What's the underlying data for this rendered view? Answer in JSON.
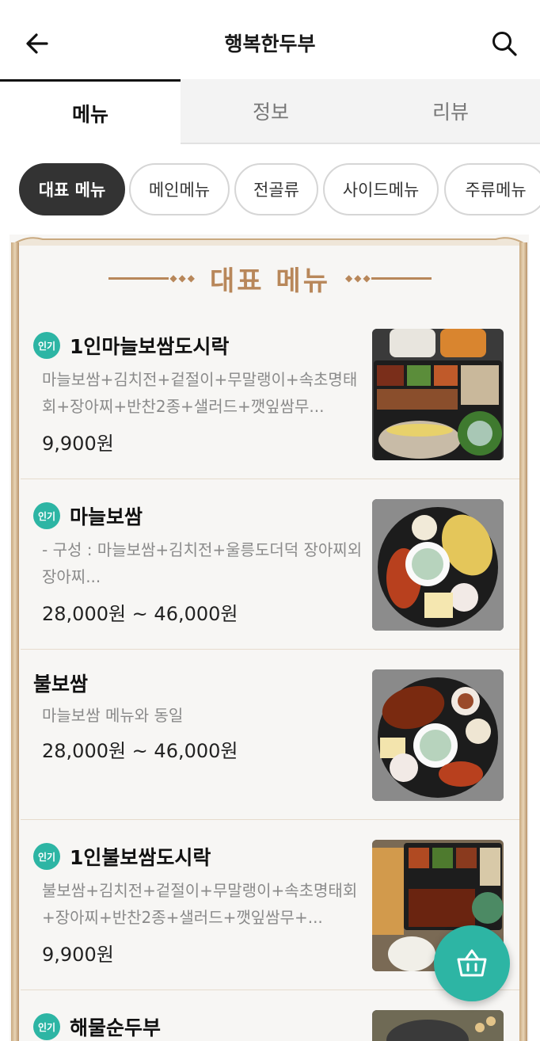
{
  "header": {
    "title": "행복한두부"
  },
  "tabs": [
    {
      "label": "메뉴",
      "active": true
    },
    {
      "label": "정보",
      "active": false
    },
    {
      "label": "리뷰",
      "active": false
    }
  ],
  "chips": [
    {
      "label": "대표 메뉴",
      "active": true
    },
    {
      "label": "메인메뉴",
      "active": false
    },
    {
      "label": "전골류",
      "active": false
    },
    {
      "label": "사이드메뉴",
      "active": false
    },
    {
      "label": "주류메뉴",
      "active": false
    }
  ],
  "section": {
    "title": "대표 메뉴"
  },
  "badge_label": "인기",
  "items": [
    {
      "name": "1인마늘보쌈도시락",
      "popular": true,
      "desc": "마늘보쌈+김치전+겉절이+무말랭이+속초명태회+장아찌+반찬2종+샐러드+깻잎쌈무...",
      "price": "9,900원"
    },
    {
      "name": "마늘보쌈",
      "popular": true,
      "desc": "- 구성 : 마늘보쌈+김치전+울릉도더덕 장아찌외 장아찌...",
      "price": "28,000원 ~ 46,000원"
    },
    {
      "name": "불보쌈",
      "popular": false,
      "desc": "마늘보쌈 메뉴와 동일",
      "price": "28,000원 ~ 46,000원"
    },
    {
      "name": "1인불보쌈도시락",
      "popular": true,
      "desc": "불보쌈+김치전+겉절이+무말랭이+속초명태회+장아찌+반찬2종+샐러드+깻잎쌈무+...",
      "price": "9,900원"
    },
    {
      "name": "해물순두부",
      "popular": true,
      "desc": "",
      "price": ""
    }
  ],
  "colors": {
    "accent": "#2db5a4",
    "gold": "#b8875a",
    "dark_chip": "#333333"
  },
  "icons": {
    "back": "arrow-left-icon",
    "search": "search-icon",
    "cart": "basket-icon"
  }
}
